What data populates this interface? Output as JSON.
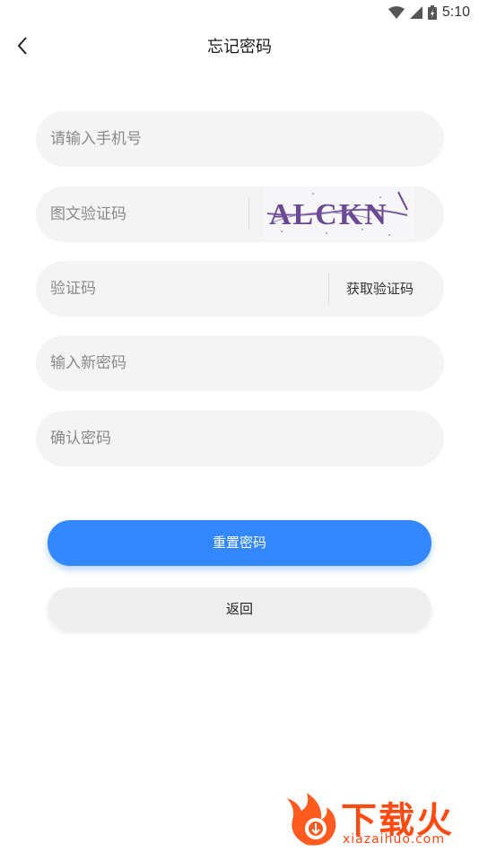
{
  "status_bar": {
    "time": "5:10",
    "icons": [
      "wifi-icon",
      "signal-icon",
      "battery-icon"
    ]
  },
  "header": {
    "title": "忘记密码",
    "back_icon": "chevron-left-icon"
  },
  "form": {
    "phone_placeholder": "请输入手机号",
    "captcha_placeholder": "图文验证码",
    "captcha_image_text": "ALCKN",
    "code_placeholder": "验证码",
    "get_code_label": "获取验证码",
    "new_password_placeholder": "输入新密码",
    "confirm_password_placeholder": "确认密码"
  },
  "buttons": {
    "reset_label": "重置密码",
    "back_label": "返回"
  },
  "watermark": {
    "text": "下载火",
    "url": "xiazaihuo.com"
  },
  "colors": {
    "primary": "#3388ff",
    "field_bg": "#f4f4f4",
    "watermark": "#ff4a12"
  }
}
